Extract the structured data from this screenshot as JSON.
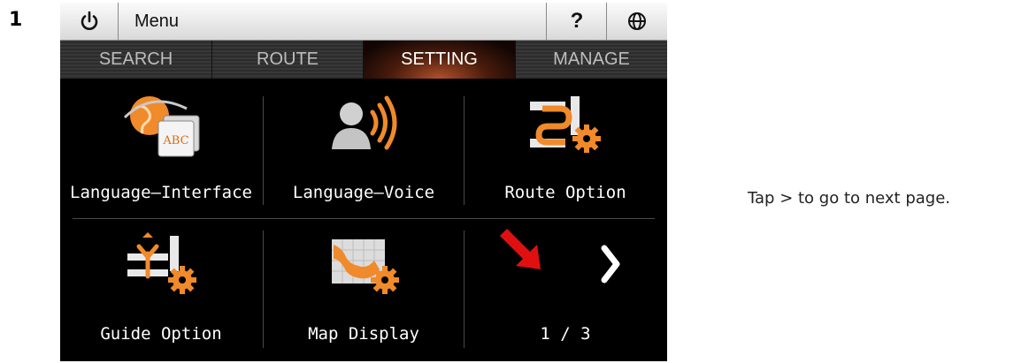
{
  "step": "1",
  "instruction": "Tap > to go to next page.",
  "titlebar": {
    "power_icon": "power-icon",
    "menu_label": "Menu",
    "help_label": "?",
    "globe_icon": "globe-icon"
  },
  "tabs": [
    {
      "label": "SEARCH",
      "active": false
    },
    {
      "label": "ROUTE",
      "active": false
    },
    {
      "label": "SETTING",
      "active": true
    },
    {
      "label": "MANAGE",
      "active": false
    }
  ],
  "grid": [
    {
      "label": "Language—Interface",
      "icon": "language-interface-icon"
    },
    {
      "label": "Language—Voice",
      "icon": "language-voice-icon"
    },
    {
      "label": "Route Option",
      "icon": "route-option-icon"
    },
    {
      "label": "Guide Option",
      "icon": "guide-option-icon"
    },
    {
      "label": "Map Display",
      "icon": "map-display-icon"
    },
    {
      "label": "1 / 3",
      "icon": "next-page-icon"
    }
  ],
  "colors": {
    "accent_orange": "#f08a2a",
    "annotation_red": "#e01010",
    "active_tab": "#7a2a10"
  }
}
